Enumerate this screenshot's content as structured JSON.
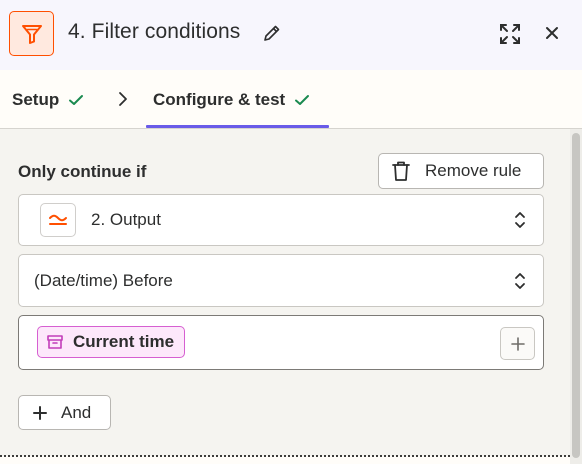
{
  "header": {
    "title": "4. Filter conditions",
    "app_icon": "filter-icon",
    "accent_color": "#ff4f00",
    "edit_icon": "pencil-icon",
    "expand_icon": "expand-icon",
    "close_icon": "close-icon"
  },
  "tabs": [
    {
      "label": "Setup",
      "complete": true,
      "active": false
    },
    {
      "label": "Configure & test",
      "complete": true,
      "active": true
    }
  ],
  "tab_active_color": "#695be8",
  "check_color": "#1a8a50",
  "rule": {
    "heading": "Only continue if",
    "remove_label": "Remove rule",
    "field": {
      "label": "2. Output",
      "icon": "formatter-icon"
    },
    "condition": {
      "label": "(Date/time) Before"
    },
    "value": {
      "pill_label": "Current time",
      "pill_icon": "archive-box-icon",
      "pill_color": "#d65fd1"
    }
  },
  "and_label": "And"
}
